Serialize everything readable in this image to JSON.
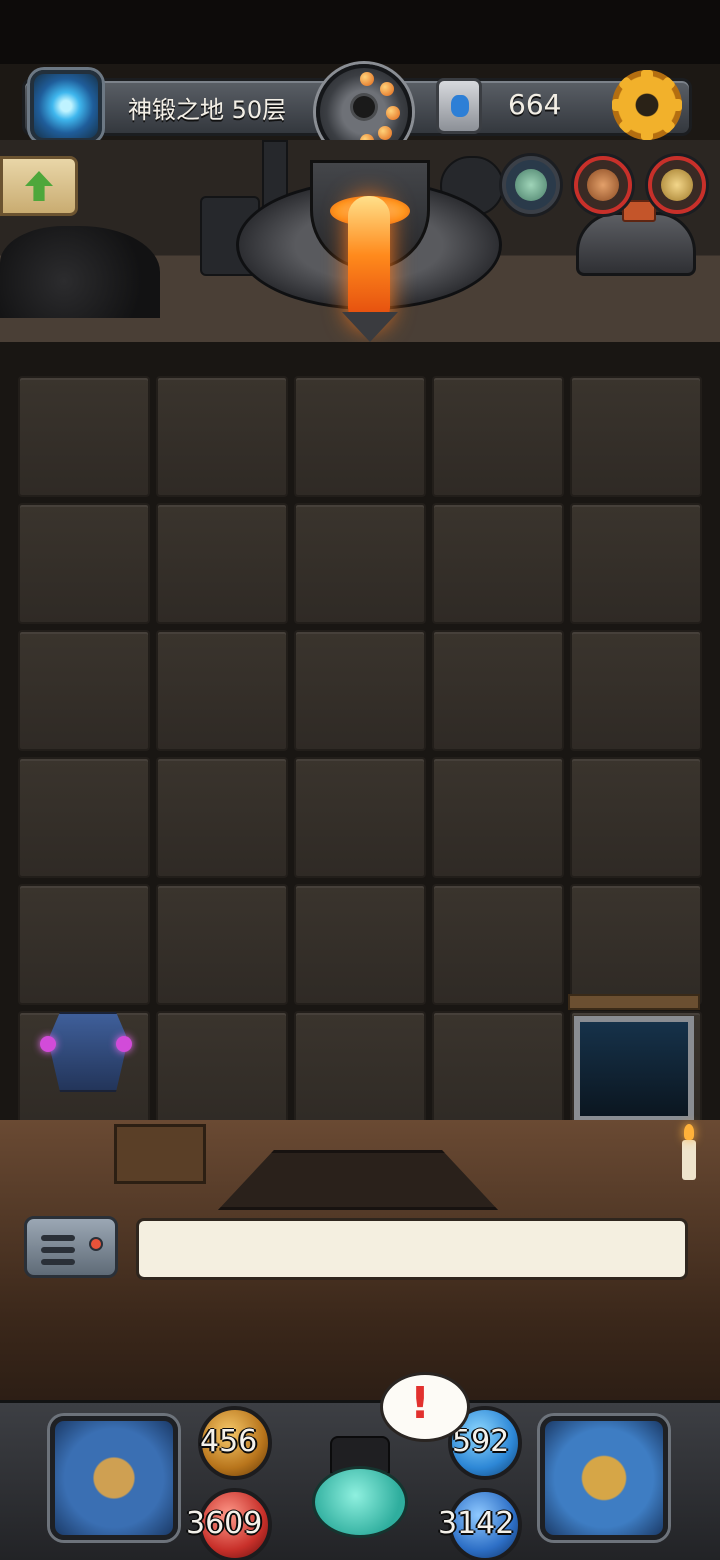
{
  "header": {
    "floor_label": "神锻之地 50层",
    "currency_value": "664",
    "icons": [
      "portal-icon",
      "anvil-badge-icon",
      "rune-stone-icon",
      "gear-icon"
    ]
  },
  "forge": {
    "upgrade_button_icon": "up-arrow-icon",
    "hero_portraits": [
      "hero-portrait-1",
      "hero-portrait-2",
      "hero-portrait-3"
    ]
  },
  "board": {
    "columns": 5,
    "rows": 6,
    "items": [
      "armor-icon",
      "stairs-exit-icon"
    ]
  },
  "message": {
    "text": ""
  },
  "hud": {
    "attack": "456",
    "defense": "592",
    "hp": "3609",
    "mp": "3142",
    "alert_mark": "!"
  },
  "colors": {
    "lava": "#ff8a1c",
    "gear_gold": "#f2b12b",
    "hp_red": "#c8302a",
    "mp_blue": "#2d6fc6"
  }
}
